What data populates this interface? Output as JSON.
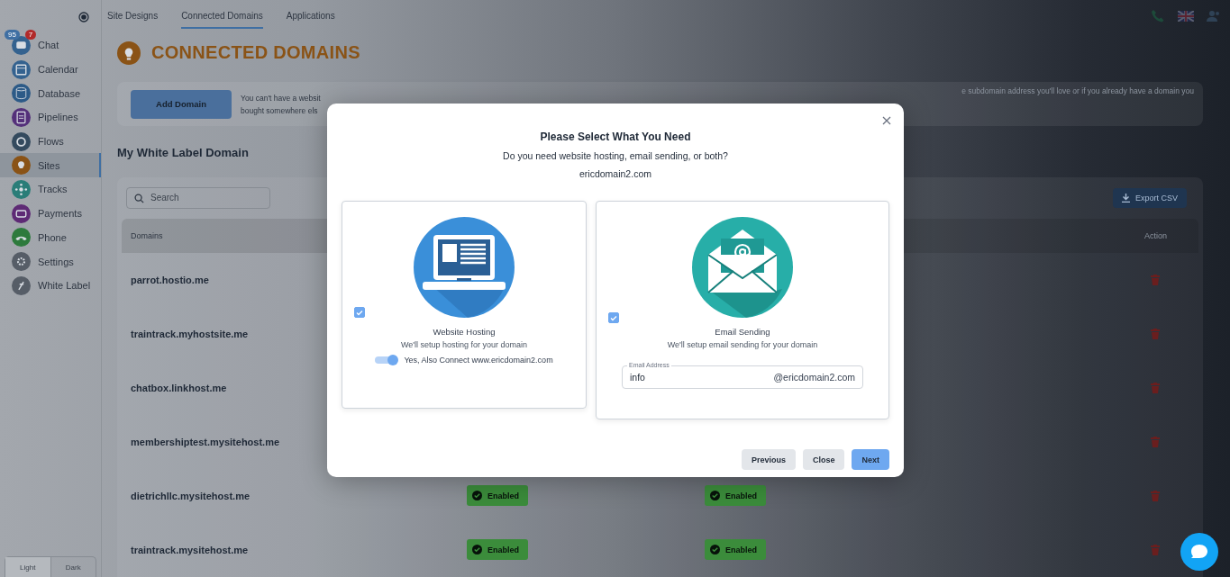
{
  "sidebar": {
    "items": [
      {
        "label": "Chat",
        "selected": false,
        "color": "#34628f",
        "badges": [
          {
            "text": "95",
            "kind": "info"
          },
          {
            "text": "7",
            "kind": "alert"
          }
        ]
      },
      {
        "label": "Calendar",
        "selected": false,
        "color": "#34628f"
      },
      {
        "label": "Database",
        "selected": false,
        "color": "#2c5a87"
      },
      {
        "label": "Pipelines",
        "selected": false,
        "color": "#54307a"
      },
      {
        "label": "Flows",
        "selected": false,
        "color": "#344a5e"
      },
      {
        "label": "Sites",
        "selected": true,
        "color": "#8a5316"
      },
      {
        "label": "Tracks",
        "selected": false,
        "color": "#2a7d78"
      },
      {
        "label": "Payments",
        "selected": false,
        "color": "#5e2a75"
      },
      {
        "label": "Phone",
        "selected": false,
        "color": "#2d7a3c"
      },
      {
        "label": "Settings",
        "selected": false,
        "color": "#565d67"
      },
      {
        "label": "White Label",
        "selected": false,
        "color": "#565d67"
      }
    ],
    "theme_toggle": [
      {
        "label": "Light",
        "selected": true
      },
      {
        "label": "Dark",
        "selected": false
      }
    ]
  },
  "tabs": [
    {
      "label": "Site Designs",
      "selected": false
    },
    {
      "label": "Connected Domains",
      "selected": true
    },
    {
      "label": "Applications",
      "selected": false
    }
  ],
  "page_title": "CONNECTED DOMAINS",
  "intro": {
    "button": "Add Domain",
    "text_left": [
      "You can't have a websit",
      "bought somewhere els"
    ],
    "text_right": "e subdomain address you'll love or if you already have a domain you"
  },
  "section_title": "My White Label Domain",
  "table": {
    "search_placeholder": "Search",
    "export_button": "Export CSV",
    "columns": [
      {
        "label": "Domains"
      },
      {
        "label": "Action"
      }
    ],
    "rows": [
      {
        "domain": "parrot.hostio.me"
      },
      {
        "domain": "traintrack.myhostsite.me"
      },
      {
        "domain": "chatbox.linkhost.me"
      },
      {
        "domain": "membershiptest.mysitehost.me"
      },
      {
        "domain": "dietrichllc.mysitehost.me",
        "status_1": "Enabled",
        "status_2": "Enabled"
      },
      {
        "domain": "traintrack.mysitehost.me",
        "status_1": "Enabled",
        "status_2": "Enabled"
      }
    ]
  },
  "modal": {
    "title": "Please Select What You Need",
    "subtitle": "Do you need website hosting, email sending, or both?",
    "domain": "ericdomain2.com",
    "options": [
      {
        "kind": "hosting",
        "checked": true,
        "title": "Website Hosting",
        "description": "We'll setup hosting for your domain",
        "toggle": {
          "label": "Yes, Also Connect www.ericdomain2.com",
          "on": true
        }
      },
      {
        "kind": "email",
        "checked": true,
        "title": "Email Sending",
        "description": "We'll setup email sending for your domain",
        "field": {
          "label": "Email Address",
          "value": "info",
          "suffix": "@ericdomain2.com"
        }
      }
    ],
    "buttons": [
      {
        "label": "Previous",
        "kind": "secondary"
      },
      {
        "label": "Close",
        "kind": "secondary"
      },
      {
        "label": "Next",
        "kind": "primary"
      }
    ]
  }
}
